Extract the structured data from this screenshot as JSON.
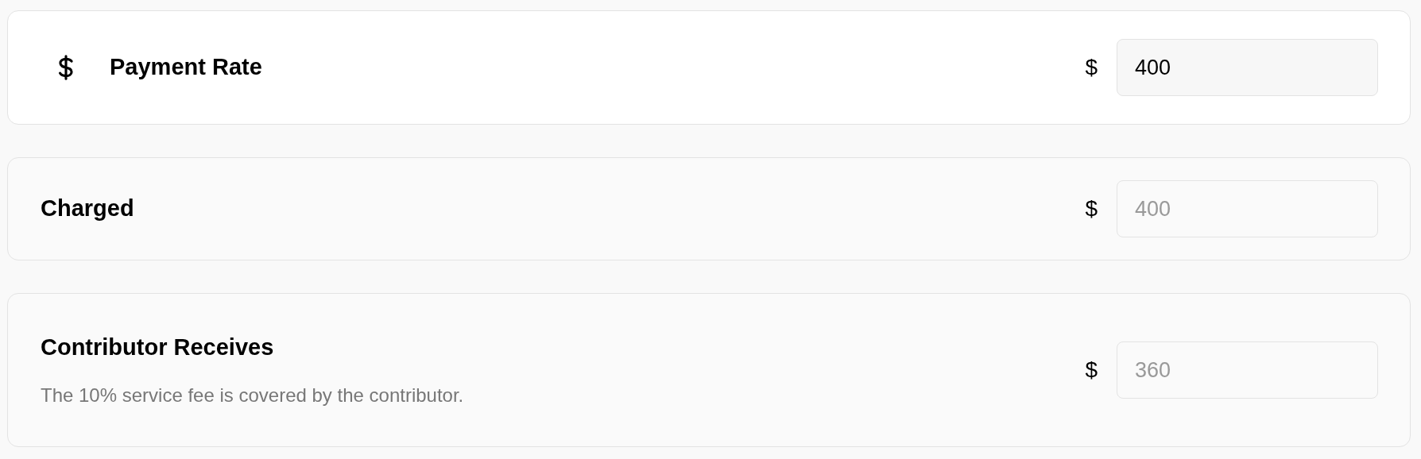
{
  "rows": [
    {
      "title": "Payment Rate",
      "has_icon": true,
      "currency": "$",
      "value": "400",
      "disabled": false
    },
    {
      "title": "Charged",
      "has_icon": false,
      "currency": "$",
      "value": "400",
      "disabled": true
    },
    {
      "title": "Contributor Receives",
      "description": "The 10% service fee is covered by the contributor.",
      "has_icon": false,
      "currency": "$",
      "value": "360",
      "disabled": true
    }
  ]
}
